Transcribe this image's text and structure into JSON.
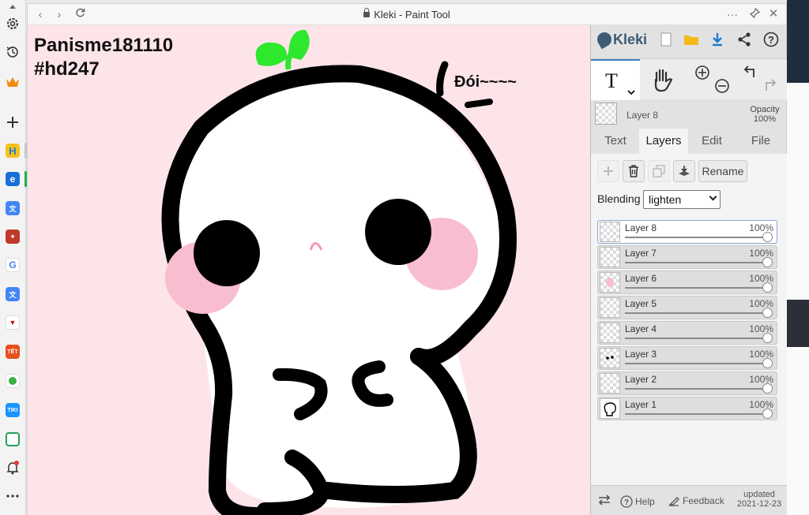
{
  "window": {
    "title": "Kleki - Paint Tool"
  },
  "canvas": {
    "caption_line1": "Panisme181110",
    "caption_line2": "#hd247",
    "speech": "Đói~~~~",
    "background_color": "#fde4e8"
  },
  "panel": {
    "app_name": "Kleki",
    "current_layer_label": "Layer 8",
    "opacity_label": "Opacity",
    "opacity_value": "100%",
    "tabs": [
      {
        "label": "Text"
      },
      {
        "label": "Layers"
      },
      {
        "label": "Edit"
      },
      {
        "label": "File"
      }
    ],
    "active_tab": "Layers",
    "rename_label": "Rename",
    "blending_label": "Blending",
    "blending_value": "lighten",
    "layers": [
      {
        "name": "Layer 8",
        "opacity": "100%"
      },
      {
        "name": "Layer 7",
        "opacity": "100%"
      },
      {
        "name": "Layer 6",
        "opacity": "100%"
      },
      {
        "name": "Layer 5",
        "opacity": "100%"
      },
      {
        "name": "Layer 4",
        "opacity": "100%"
      },
      {
        "name": "Layer 3",
        "opacity": "100%"
      },
      {
        "name": "Layer 2",
        "opacity": "100%"
      },
      {
        "name": "Layer 1",
        "opacity": "100%"
      }
    ],
    "footer": {
      "help": "Help",
      "feedback": "Feedback",
      "updated_label": "updated",
      "updated_date": "2021-12-23"
    }
  },
  "colors": {
    "accent": "#3c7fb6",
    "logo": "#3d5b74",
    "canvas_bg": "#fde4e8",
    "blush": "#f9bdd0",
    "sprout": "#2ee82e"
  }
}
